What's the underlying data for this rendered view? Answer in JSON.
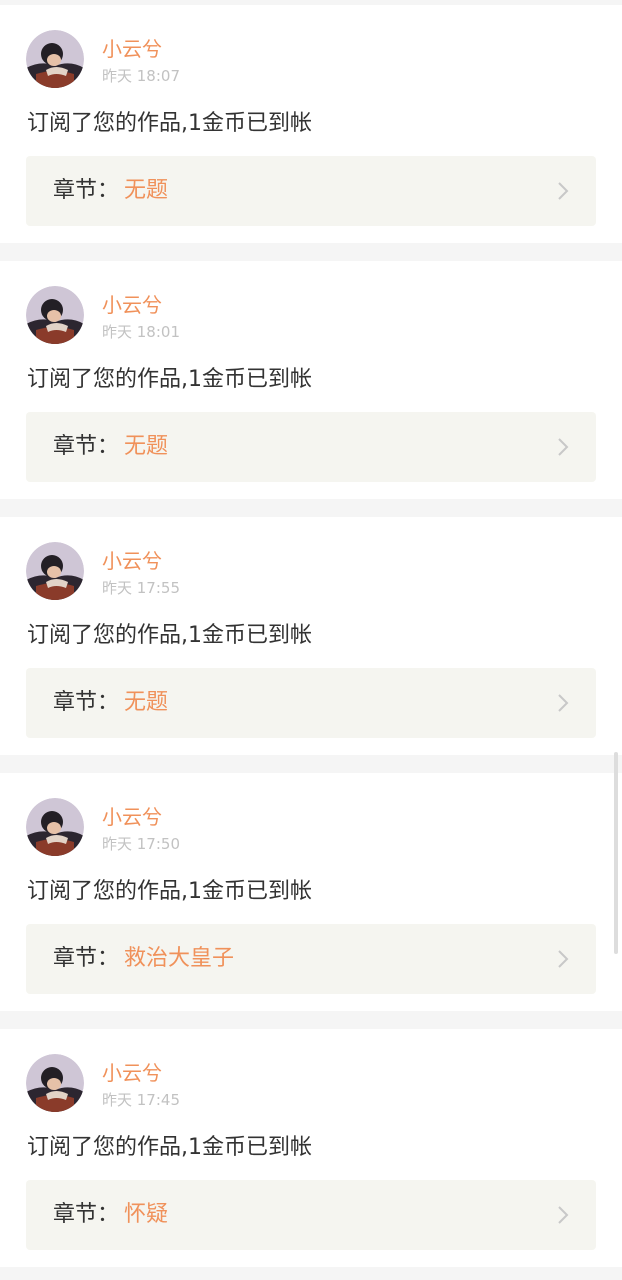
{
  "notifications": [
    {
      "username": "小云兮",
      "time": "昨天 18:07",
      "message": "订阅了您的作品,1金币已到帐",
      "chapter_label": "章节：",
      "chapter_title": "无题"
    },
    {
      "username": "小云兮",
      "time": "昨天 18:01",
      "message": "订阅了您的作品,1金币已到帐",
      "chapter_label": "章节：",
      "chapter_title": "无题"
    },
    {
      "username": "小云兮",
      "time": "昨天 17:55",
      "message": "订阅了您的作品,1金币已到帐",
      "chapter_label": "章节：",
      "chapter_title": "无题"
    },
    {
      "username": "小云兮",
      "time": "昨天 17:50",
      "message": "订阅了您的作品,1金币已到帐",
      "chapter_label": "章节：",
      "chapter_title": "救治大皇子"
    },
    {
      "username": "小云兮",
      "time": "昨天 17:45",
      "message": "订阅了您的作品,1金币已到帐",
      "chapter_label": "章节：",
      "chapter_title": "怀疑"
    }
  ],
  "colors": {
    "accent": "#f0915a",
    "text": "#333333",
    "muted": "#c2c2c2",
    "card": "#ffffff",
    "chapter_bg": "#f5f5f0",
    "page_bg": "#f5f5f5"
  },
  "icons": {
    "avatar": "user-avatar-icon",
    "chevron": "chevron-right-icon"
  }
}
